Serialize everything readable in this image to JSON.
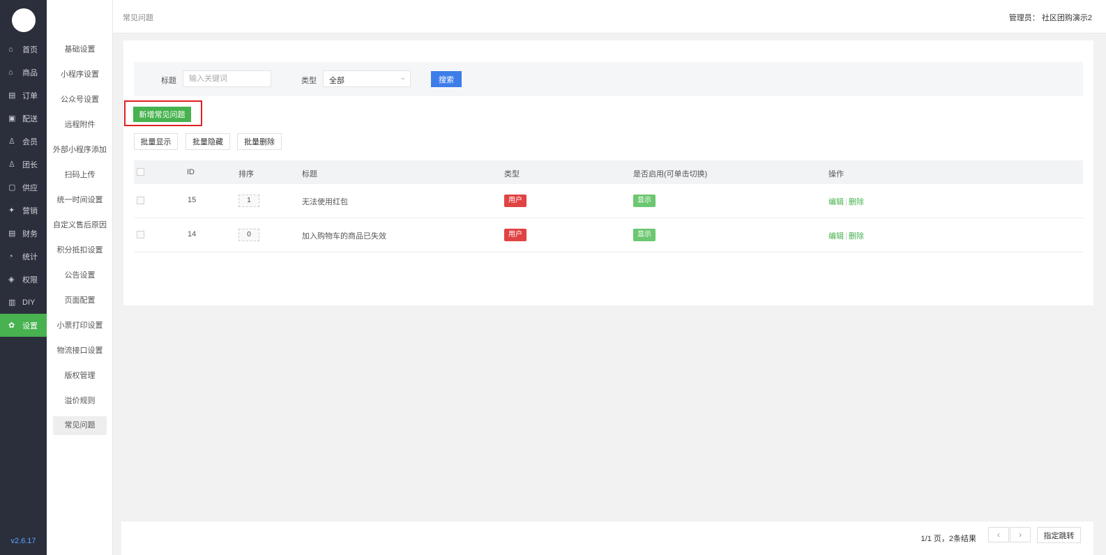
{
  "nav": {
    "items": [
      {
        "icon": "home-icon",
        "glyph": "⌂",
        "label": "首页"
      },
      {
        "icon": "shop-icon",
        "glyph": "⌂",
        "label": "商品"
      },
      {
        "icon": "order-icon",
        "glyph": "▤",
        "label": "订单"
      },
      {
        "icon": "delivery-icon",
        "glyph": "▣",
        "label": "配送"
      },
      {
        "icon": "member-icon",
        "glyph": "♙",
        "label": "会员"
      },
      {
        "icon": "leader-icon",
        "glyph": "♙",
        "label": "团长"
      },
      {
        "icon": "supply-icon",
        "glyph": "▢",
        "label": "供应"
      },
      {
        "icon": "marketing-icon",
        "glyph": "✦",
        "label": "营销"
      },
      {
        "icon": "finance-icon",
        "glyph": "▤",
        "label": "财务"
      },
      {
        "icon": "stats-icon",
        "glyph": "◔",
        "label": "统计"
      },
      {
        "icon": "permission-icon",
        "glyph": "◈",
        "label": "权限"
      },
      {
        "icon": "diy-icon",
        "glyph": "▥",
        "label": "DIY"
      },
      {
        "icon": "settings-icon",
        "glyph": "✿",
        "label": "设置"
      }
    ],
    "version": "v2.6.17"
  },
  "submenu": {
    "items": [
      "基础设置",
      "小程序设置",
      "公众号设置",
      "远程附件",
      "外部小程序添加",
      "扫码上传",
      "统一时间设置",
      "自定义售后原因",
      "积分抵扣设置",
      "公告设置",
      "页面配置",
      "小票打印设置",
      "物流接口设置",
      "版权管理",
      "溢价规则",
      "常见问题"
    ]
  },
  "header": {
    "breadcrumb": "常见问题",
    "admin": "管理员： 社区团购演示2"
  },
  "filter": {
    "title_label": "标题",
    "title_placeholder": "输入关键词",
    "type_label": "类型",
    "type_value": "全部",
    "search_button": "搜索"
  },
  "actions": {
    "add_button": "新增常见问题",
    "bulk_show": "批量显示",
    "bulk_hide": "批量隐藏",
    "bulk_delete": "批量删除"
  },
  "table": {
    "headers": {
      "id": "ID",
      "sort": "排序",
      "title": "标题",
      "type": "类型",
      "enabled": "是否启用(可单击切换)",
      "ops": "操作"
    },
    "rows": [
      {
        "id": "15",
        "sort": "1",
        "title": "无法使用红包",
        "type": "用户",
        "status": "显示",
        "edit": "编辑",
        "delete": "删除"
      },
      {
        "id": "14",
        "sort": "0",
        "title": "加入购物车的商品已失效",
        "type": "用户",
        "status": "显示",
        "edit": "编辑",
        "delete": "删除"
      }
    ]
  },
  "pagination": {
    "info": "1/1 页，2条结果",
    "prev": "‹",
    "next": "›",
    "jump_button": "指定跳转"
  },
  "colors": {
    "accent_green": "#47b24f",
    "primary_blue": "#3d7de8",
    "danger_red": "#e04343",
    "nav_bg": "#2b2e3b"
  }
}
